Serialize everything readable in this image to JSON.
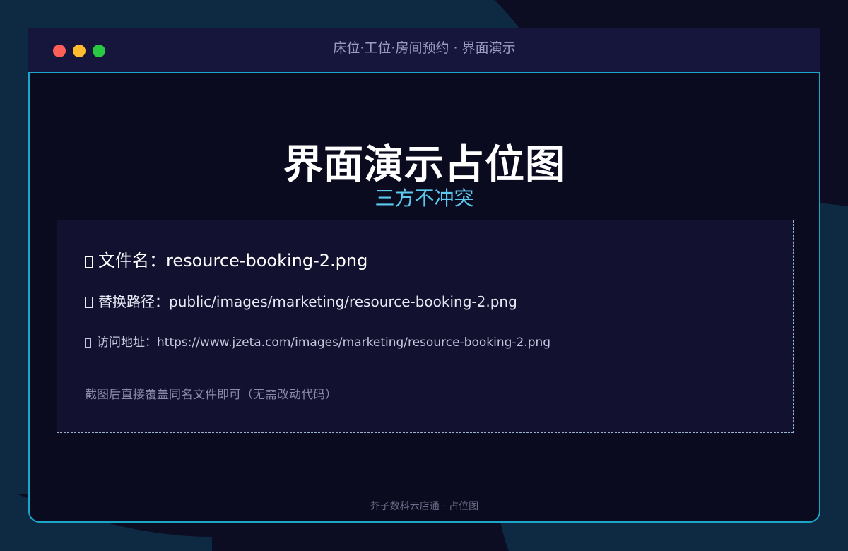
{
  "window": {
    "title": "床位·工位·房间预约 · 界面演示",
    "controls": [
      "close",
      "minimize",
      "maximize"
    ]
  },
  "placeholder": {
    "title": "界面演示占位图",
    "subtitle": "三方不冲突",
    "filename_label": "文件名：",
    "filename": "resource-booking-2.png",
    "replace_path_label": "替换路径：",
    "replace_path": "public/images/marketing/resource-booking-2.png",
    "access_url_label": "访问地址：",
    "access_url": "https://www.jzeta.com/images/marketing/resource-booking-2.png",
    "note": "截图后直接覆盖同名文件即可（无需改动代码）"
  },
  "footer": {
    "text": "芥子数科云店通 · 占位图"
  },
  "colors": {
    "background": "#0c0c22",
    "titlebar": "#16163d",
    "accent": "#1ba6c9",
    "subtitle": "#5cc9ee",
    "close": "#ff5f57",
    "minimize": "#febc2e",
    "maximize": "#28c840"
  }
}
